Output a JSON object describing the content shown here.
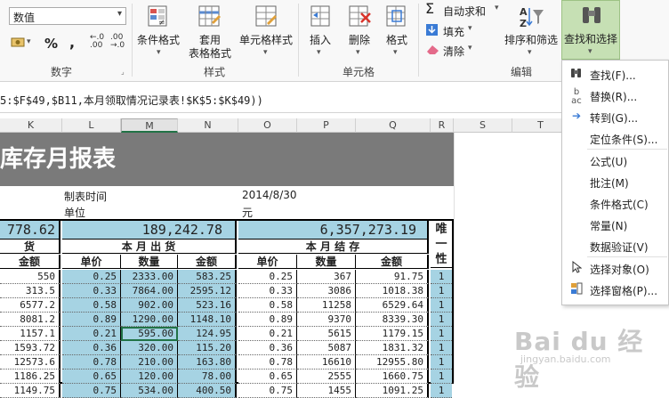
{
  "ribbon": {
    "number_format": "数值",
    "percent_symbol": "%",
    "comma_symbol": ",",
    "inc_decimal": "←.0\n.00",
    "dec_decimal": ".00\n→.0",
    "group_number": "数字",
    "conditional_format": "条件格式",
    "table_style": "套用\n表格格式",
    "cell_style": "单元格样式",
    "group_styles": "样式",
    "insert": "插入",
    "delete": "删除",
    "format": "格式",
    "group_cells": "单元格",
    "autosum": "自动求和",
    "fill": "填充",
    "clear": "清除",
    "sort_filter": "排序和筛选",
    "find_select": "查找和选择",
    "group_edit": "编辑"
  },
  "formula_text": "5:$F$49,$B11,本月领取情况记录表!$K$5:$K$49))",
  "columns": [
    "K",
    "L",
    "M",
    "N",
    "O",
    "P",
    "Q",
    "R",
    "S",
    "T"
  ],
  "sheet": {
    "title": "库存月报表",
    "meta_label1": "制表时间",
    "meta_value1": "2014/8/30",
    "meta_label2": "单位",
    "meta_value2": "元",
    "total_in": "778.62",
    "total_out": "189,242.78",
    "total_end": "6,357,273.19",
    "unique_label": "唯一性",
    "hdr_goods": "货",
    "hdr_out": "本 月 出 货",
    "hdr_end": "本 月 结 存",
    "sub_amount": "金额",
    "sub_price": "单价",
    "sub_qty": "数量",
    "rows": [
      [
        "550",
        "0.25",
        "2333.00",
        "583.25",
        "0.25",
        "367",
        "91.75",
        "1"
      ],
      [
        "313.5",
        "0.33",
        "7864.00",
        "2595.12",
        "0.33",
        "3086",
        "1018.38",
        "1"
      ],
      [
        "6577.2",
        "0.58",
        "902.00",
        "523.16",
        "0.58",
        "11258",
        "6529.64",
        "1"
      ],
      [
        "8081.2",
        "0.89",
        "1290.00",
        "1148.10",
        "0.89",
        "9370",
        "8339.30",
        "1"
      ],
      [
        "1157.1",
        "0.21",
        "595.00",
        "124.95",
        "0.21",
        "5615",
        "1179.15",
        "1"
      ],
      [
        "1593.72",
        "0.36",
        "320.00",
        "115.20",
        "0.36",
        "5087",
        "1831.32",
        "1"
      ],
      [
        "12573.6",
        "0.78",
        "210.00",
        "163.80",
        "0.78",
        "16610",
        "12955.80",
        "1"
      ],
      [
        "1186.25",
        "0.65",
        "120.00",
        "78.00",
        "0.65",
        "2555",
        "1660.75",
        "1"
      ],
      [
        "1149.75",
        "0.75",
        "534.00",
        "400.50",
        "0.75",
        "1455",
        "1091.25",
        "1"
      ]
    ]
  },
  "menu": {
    "items": [
      {
        "label": "查找(F)...",
        "icon": "binoculars-icon"
      },
      {
        "label": "替换(R)...",
        "icon": "replace-icon"
      },
      {
        "label": "转到(G)...",
        "icon": "arrow-right-icon"
      },
      {
        "label": "定位条件(S)...",
        "icon": ""
      },
      {
        "label": "公式(U)",
        "icon": ""
      },
      {
        "label": "批注(M)",
        "icon": ""
      },
      {
        "label": "条件格式(C)",
        "icon": ""
      },
      {
        "label": "常量(N)",
        "icon": ""
      },
      {
        "label": "数据验证(V)",
        "icon": ""
      },
      {
        "label": "选择对象(O)",
        "icon": "cursor-icon"
      },
      {
        "label": "选择窗格(P)...",
        "icon": "pane-icon"
      }
    ]
  },
  "watermark": {
    "main": "Bai du 经验",
    "sub": "jingyan.baidu.com"
  },
  "colors": {
    "excel_green": "#217346",
    "header_blue": "#a6d3e3",
    "title_gray": "#7a7a7a"
  }
}
